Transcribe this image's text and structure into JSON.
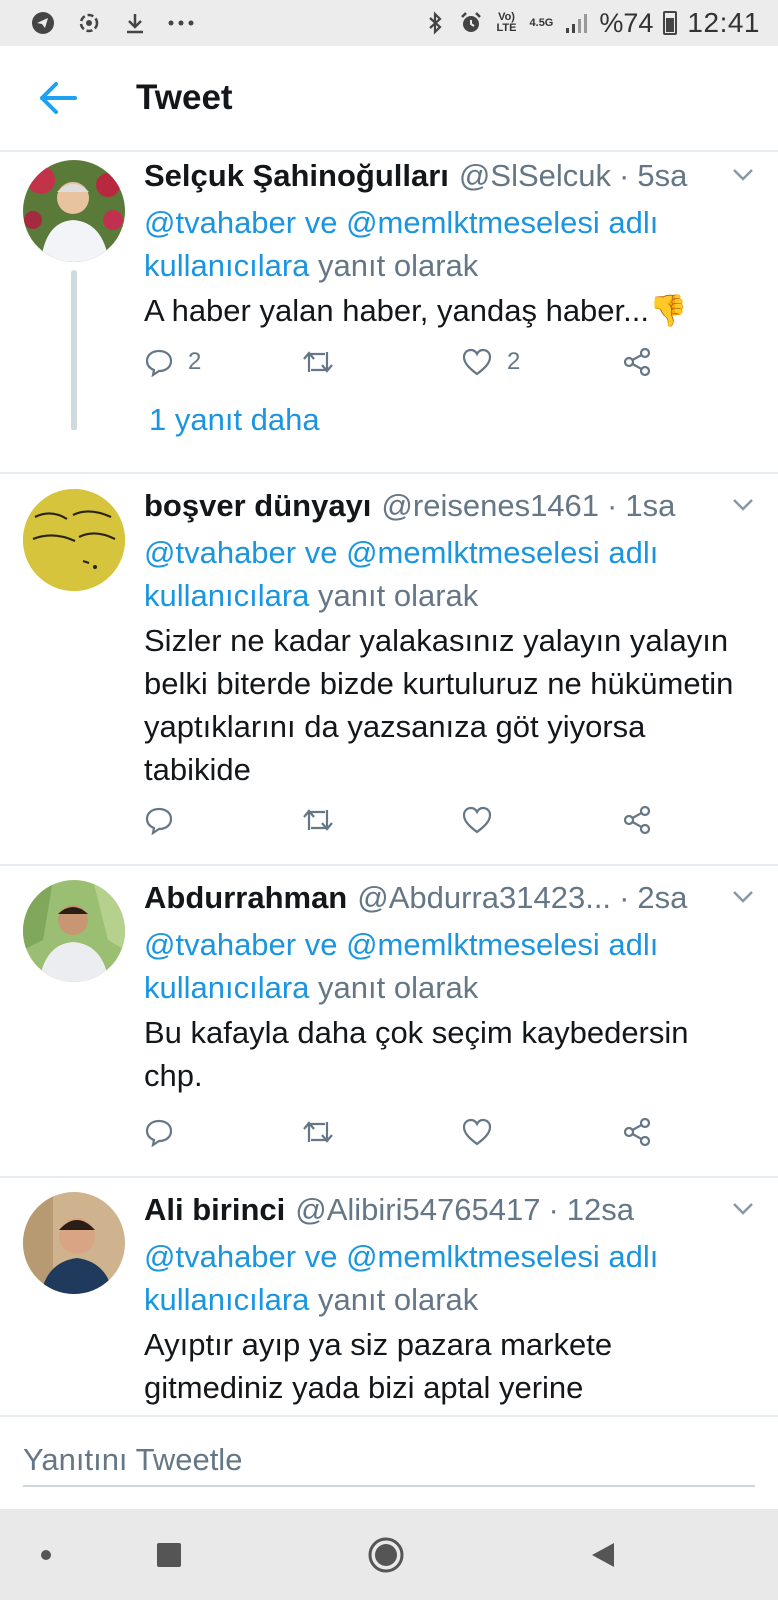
{
  "status_bar": {
    "lte": "Vo) LTE",
    "signal_type": "4.5G",
    "battery": "%74",
    "time": "12:41"
  },
  "header": {
    "title": "Tweet"
  },
  "tweets": [
    {
      "name": "Selçuk Şahinoğulları",
      "handle": "@SlSelcuk",
      "time": "5sa",
      "reply_mentions": "@tvahaber ve @memlktmeselesi adlı kullanıcılara",
      "reply_suffix": "yanıt olarak",
      "text": "A haber yalan haber, yandaş haber...👎",
      "reply_count": "2",
      "retweet_count": "",
      "like_count": "2",
      "more_replies": "1 yanıt daha"
    },
    {
      "name": "boşver dünyayı",
      "handle": "@reisenes1461",
      "time": "1sa",
      "reply_mentions": "@tvahaber ve @memlktmeselesi adlı kullanıcılara",
      "reply_suffix": "yanıt olarak",
      "text": "Sizler ne kadar yalakasınız yalayın yalayın belki biterde bizde kurtuluruz ne hükümetin yaptıklarını da yazsanıza göt yiyorsa tabikide",
      "avatar_text": "سر من الجهل جونكه جهالت"
    },
    {
      "name": "Abdurrahman",
      "handle": "@Abdurra31423...",
      "time": "2sa",
      "reply_mentions": "@tvahaber ve @memlktmeselesi adlı kullanıcılara",
      "reply_suffix": "yanıt olarak",
      "text": "Bu kafayla daha çok seçim kaybedersin chp."
    },
    {
      "name": "Ali birinci",
      "handle": "@Alibiri54765417",
      "time": "12sa",
      "reply_mentions": "@tvahaber ve @memlktmeselesi adlı kullanıcılara",
      "reply_suffix": "yanıt olarak",
      "text": "Ayıptır ayıp ya siz pazara markete gitmediniz yada bizi aptal yerine"
    }
  ],
  "reply_bar": {
    "placeholder": "Yanıtını Tweetle"
  },
  "colors": {
    "accent": "#1b95e0",
    "secondary_text": "#657786",
    "divider": "#e6ecf0"
  }
}
